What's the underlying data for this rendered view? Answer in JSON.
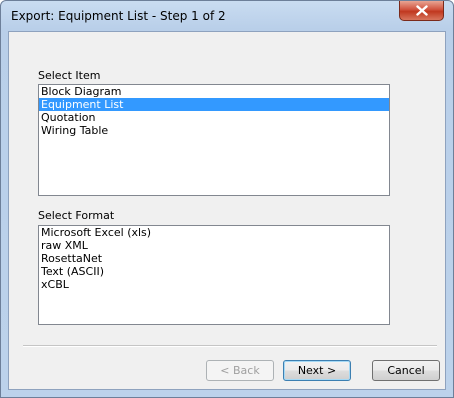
{
  "window": {
    "title": "Export: Equipment List - Step 1 of 2"
  },
  "select_item": {
    "label": "Select Item",
    "items": [
      "Block Diagram",
      "Equipment List",
      "Quotation",
      "Wiring Table"
    ],
    "selected_index": 1
  },
  "select_format": {
    "label": "Select Format",
    "items": [
      "Microsoft Excel (xls)",
      "raw XML",
      "RosettaNet",
      "Text (ASCII)",
      "xCBL"
    ]
  },
  "buttons": {
    "back": "< Back",
    "next": "Next >",
    "cancel": "Cancel"
  },
  "icons": {
    "close": "close-icon"
  },
  "colors": {
    "selection": "#3399ff",
    "close_button": "#c9462c",
    "titlebar": "#c9dcf1"
  }
}
